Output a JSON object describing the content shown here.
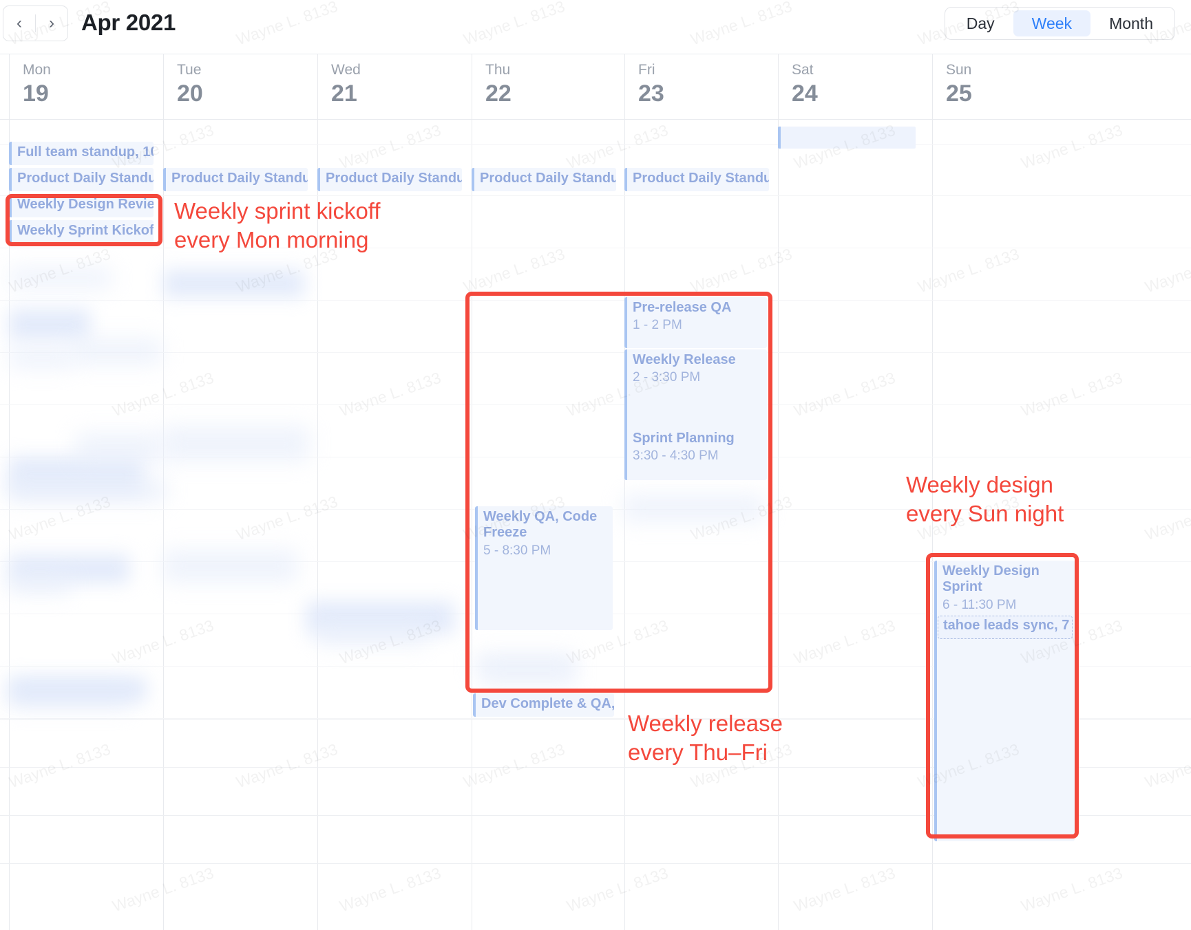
{
  "header": {
    "prev_icon": "chevron-left-icon",
    "next_icon": "chevron-right-icon",
    "title": "Apr 2021",
    "views": [
      {
        "label": "Day",
        "active": false
      },
      {
        "label": "Week",
        "active": true
      },
      {
        "label": "Month",
        "active": false
      }
    ],
    "accent_color": "#2d7ff9",
    "active_bg": "#eaf1fe"
  },
  "days": [
    {
      "dow": "Mon",
      "num": "19"
    },
    {
      "dow": "Tue",
      "num": "20"
    },
    {
      "dow": "Wed",
      "num": "21"
    },
    {
      "dow": "Thu",
      "num": "22"
    },
    {
      "dow": "Fri",
      "num": "23"
    },
    {
      "dow": "Sat",
      "num": "24"
    },
    {
      "dow": "Sun",
      "num": "25"
    }
  ],
  "events": [
    {
      "id": "e1",
      "day": "Mon",
      "title": "Full team standup, 10",
      "time": ""
    },
    {
      "id": "e2",
      "day": "Mon",
      "title": "Product Daily Standu",
      "time": ""
    },
    {
      "id": "e3",
      "day": "Mon",
      "title": "Weekly Design Revie",
      "time": ""
    },
    {
      "id": "e4",
      "day": "Mon",
      "title": "Weekly Sprint Kickof",
      "time": ""
    },
    {
      "id": "e5",
      "day": "Tue",
      "title": "Product Daily Standu",
      "time": ""
    },
    {
      "id": "e6",
      "day": "Wed",
      "title": "Product Daily Standu",
      "time": ""
    },
    {
      "id": "e7",
      "day": "Thu",
      "title": "Product Daily Standu",
      "time": ""
    },
    {
      "id": "e8",
      "day": "Fri",
      "title": "Product Daily Standu",
      "time": ""
    },
    {
      "id": "e9",
      "day": "Fri",
      "title": "Pre-release QA",
      "time": "1 - 2 PM"
    },
    {
      "id": "e10",
      "day": "Fri",
      "title": "Weekly Release",
      "time": "2 - 3:30 PM"
    },
    {
      "id": "e11",
      "day": "Fri",
      "title": "Sprint Planning",
      "time": "3:30 - 4:30 PM"
    },
    {
      "id": "e12",
      "day": "Thu",
      "title": "Weekly QA, Code Freeze",
      "time": "5 - 8:30 PM"
    },
    {
      "id": "e13",
      "day": "Thu",
      "title": "Dev Complete & QA,",
      "time": ""
    },
    {
      "id": "e14",
      "day": "Sun",
      "title": "Weekly Design Sprint",
      "time": "6 - 11:30 PM"
    }
  ],
  "chips": [
    {
      "id": "c1",
      "day": "Sun",
      "label": "tahoe leads sync, 7"
    }
  ],
  "annotations": [
    {
      "id": "a1",
      "text": "Weekly sprint kickoff\never Mon morning",
      "color": "#f4483c"
    },
    {
      "id": "a2",
      "text": "Weekly design\nevery Sun night",
      "color": "#f4483c"
    },
    {
      "id": "a3",
      "text": "Weekly release\nevery Thu–Fri",
      "color": "#f4483c"
    }
  ],
  "annotation_text": {
    "mon_kickoff": "Weekly sprint kickoff\nevery Mon morning",
    "sun_design": "Weekly design\nevery Sun night",
    "thu_release": "Weekly release\nevery Thu–Fri"
  },
  "watermark": {
    "text": "Wayne L. 8133"
  }
}
